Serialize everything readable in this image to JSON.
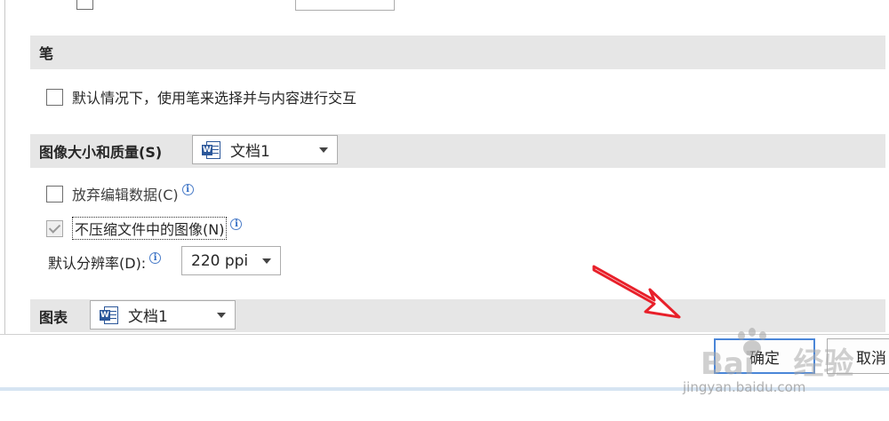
{
  "sections": {
    "pen": {
      "header": "笔",
      "option_label": "默认情况下，使用笔来选择并与内容进行交互"
    },
    "image_size_quality": {
      "header": "图像大小和质量(S)",
      "document_select": "文档1",
      "discard_edit_data": "放弃编辑数据(C)",
      "no_compress": "不压缩文件中的图像(N)",
      "default_resolution_label": "默认分辨率(D):",
      "default_resolution_value": "220 ppi"
    },
    "charts": {
      "header": "图表",
      "document_select": "文档1"
    }
  },
  "footer": {
    "ok_label": "确定",
    "cancel_label": "取消"
  },
  "watermark": {
    "brand": "Bai",
    "brand_cn": "经验",
    "url": "jingyan.baidu.com"
  },
  "icons": {
    "info": "info-icon",
    "word_doc": "word-document-icon",
    "dropdown": "chevron-down-icon",
    "annotation": "red-arrow"
  },
  "colors": {
    "section_bg": "#e6e6e6",
    "primary_border": "#4a86d8",
    "arrow": "#e8202a",
    "word_blue": "#2b579a"
  }
}
